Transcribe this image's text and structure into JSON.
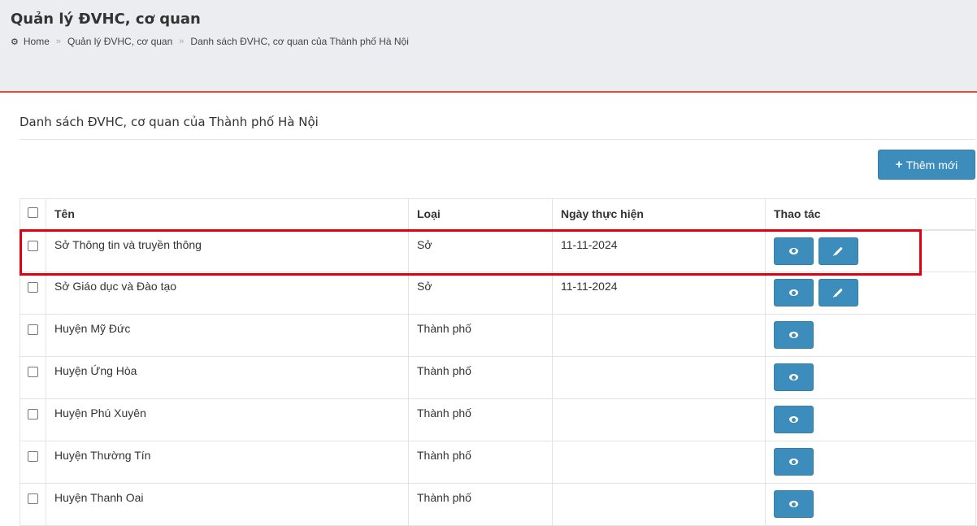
{
  "header": {
    "title": "Quản lý ĐVHC, cơ quan",
    "breadcrumb": {
      "home": "Home",
      "level1": "Quản lý ĐVHC, cơ quan",
      "level2": "Danh sách ĐVHC, cơ quan của Thành phố Hà Nội"
    }
  },
  "section": {
    "title": "Danh sách ĐVHC, cơ quan của Thành phố Hà Nội",
    "add_button": "Thêm mới"
  },
  "table": {
    "columns": [
      "Tên",
      "Loại",
      "Ngày thực hiện",
      "Thao tác"
    ],
    "rows": [
      {
        "name": "Sở Thông tin và truyền thông",
        "type": "Sở",
        "date": "11-11-2024",
        "editable": true
      },
      {
        "name": "Sở Giáo dục và Đào tạo",
        "type": "Sở",
        "date": "11-11-2024",
        "editable": true
      },
      {
        "name": "Huyện Mỹ Đức",
        "type": "Thành phố",
        "date": "",
        "editable": false
      },
      {
        "name": "Huyện Ứng Hòa",
        "type": "Thành phố",
        "date": "",
        "editable": false
      },
      {
        "name": "Huyện Phú Xuyên",
        "type": "Thành phố",
        "date": "",
        "editable": false
      },
      {
        "name": "Huyện Thường Tín",
        "type": "Thành phố",
        "date": "",
        "editable": false
      },
      {
        "name": "Huyện Thanh Oai",
        "type": "Thành phố",
        "date": "",
        "editable": false
      }
    ]
  },
  "colors": {
    "header_bg": "#ecedf0",
    "accent_line": "#dd4b39",
    "button_blue": "#3c8dbc",
    "highlight_red": "#e0000f"
  },
  "icons": {
    "home": "tachometer-icon",
    "view": "eye-icon",
    "edit": "pencil-icon",
    "add": "plus-icon"
  }
}
